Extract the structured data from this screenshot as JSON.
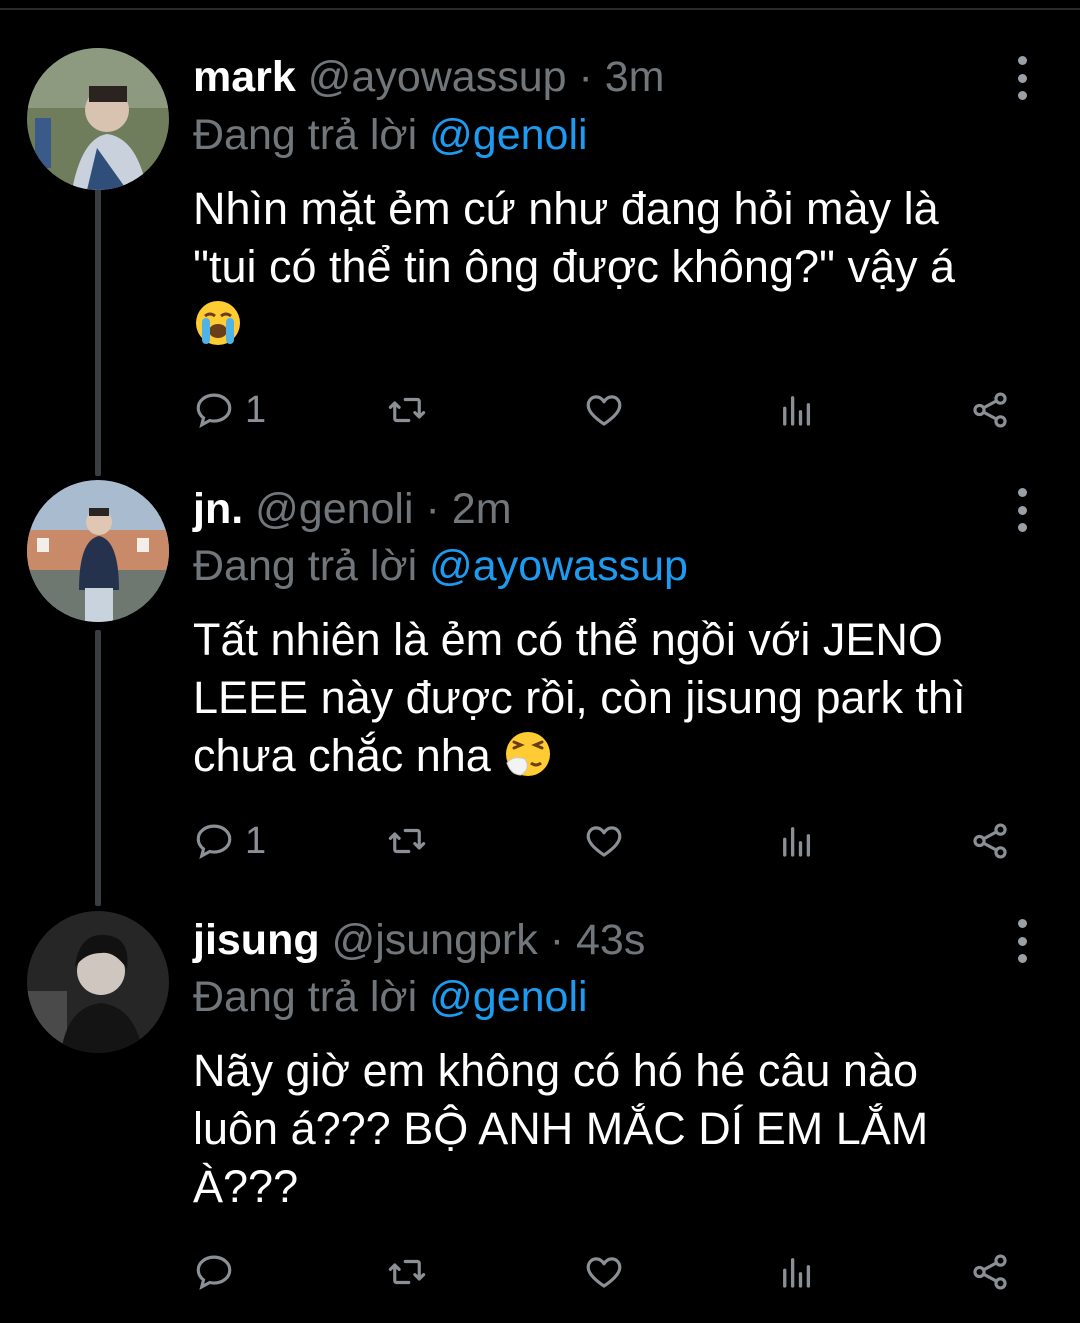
{
  "tweets": [
    {
      "name": "mark",
      "handle": "@ayowassup",
      "separator": "·",
      "time": "3m",
      "reply_prefix": "Đang trả lời",
      "reply_to": "@genoli",
      "text_lines": [
        "Nhìn mặt ẻm cứ như đang hỏi mày là",
        "\"tui có thể tin ông được không?\" vậy á"
      ],
      "emoji": "loudly-crying-face",
      "reply_count": "1",
      "colors": {
        "avatar_bg": "#7f8b6a"
      }
    },
    {
      "name": "jn.",
      "handle": "@genoli",
      "separator": "·",
      "time": "2m",
      "reply_prefix": "Đang trả lời",
      "reply_to": "@ayowassup",
      "text_lines": [
        "Tất nhiên là ẻm có thể ngồi với JENO",
        "LEEE này được rồi, còn jisung park thì",
        "chưa chắc nha"
      ],
      "emoji": "sneezing-face",
      "reply_count": "1",
      "colors": {
        "avatar_bg": "#9bb0c8"
      }
    },
    {
      "name": "jisung",
      "handle": "@jsungprk",
      "separator": "·",
      "time": "43s",
      "reply_prefix": "Đang trả lời",
      "reply_to": "@genoli",
      "text_lines": [
        "Nãy giờ em không có hó hé câu nào",
        "luôn á??? BỘ ANH MẮC DÍ EM LẮM",
        "À???"
      ],
      "emoji": "",
      "reply_count": "",
      "colors": {
        "avatar_bg": "#2e2e2e"
      }
    }
  ],
  "icons": {
    "reply": "reply-icon",
    "retweet": "retweet-icon",
    "like": "like-icon",
    "views": "views-icon",
    "share": "share-icon",
    "more": "more-icon"
  },
  "theme": {
    "background": "#000000",
    "muted": "#71767b",
    "link": "#1d9bf0",
    "thread": "#3a3d41"
  }
}
